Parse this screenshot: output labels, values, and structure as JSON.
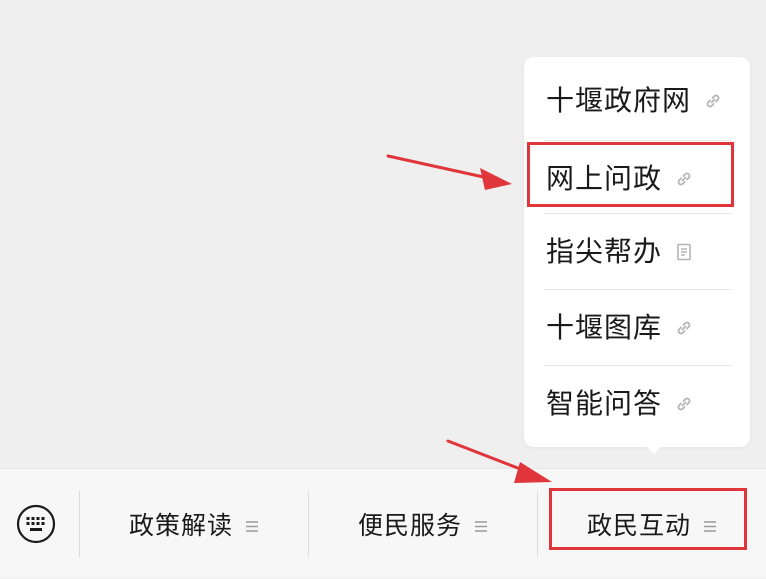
{
  "popup_menu": {
    "items": [
      {
        "label": "十堰政府网",
        "icon": "link-icon"
      },
      {
        "label": "网上问政",
        "icon": "link-icon"
      },
      {
        "label": "指尖帮办",
        "icon": "document-icon"
      },
      {
        "label": "十堰图库",
        "icon": "link-icon"
      },
      {
        "label": "智能问答",
        "icon": "link-icon"
      }
    ]
  },
  "bottom_bar": {
    "keyboard_icon": "keyboard-icon",
    "tabs": [
      {
        "label": "政策解读",
        "icon": "menu-lines-icon"
      },
      {
        "label": "便民服务",
        "icon": "menu-lines-icon"
      },
      {
        "label": "政民互动",
        "icon": "menu-lines-icon"
      }
    ]
  },
  "colors": {
    "background": "#efefef",
    "popup": "#ffffff",
    "highlight": "#e0353a",
    "text": "#1a1a1a",
    "icon_gray": "#b5b5b5"
  }
}
